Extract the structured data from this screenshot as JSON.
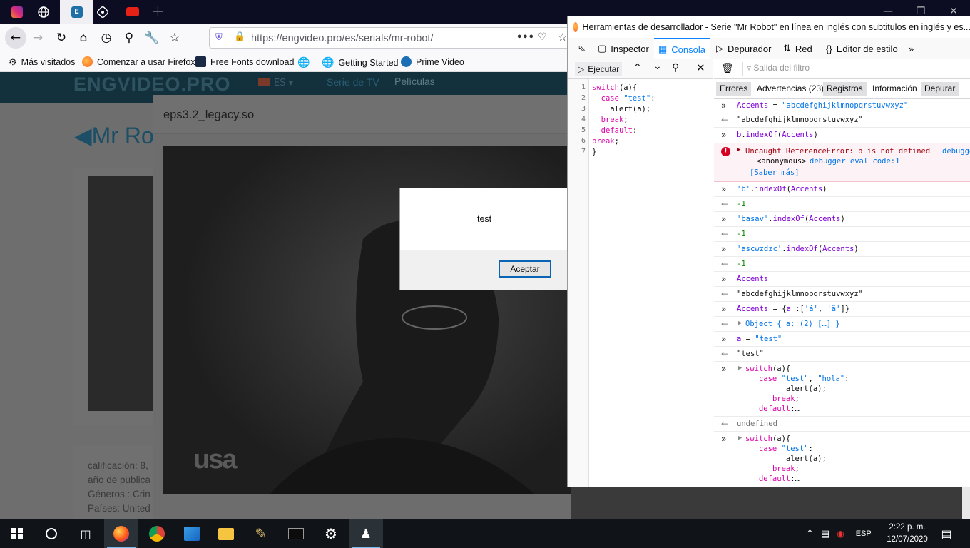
{
  "browser": {
    "tabs": [
      {
        "icon": "instagram-icon",
        "color": "#c13584"
      },
      {
        "icon": "globe-icon",
        "color": "#ffffff"
      },
      {
        "icon": "engvideo-icon",
        "color": "#2a7fb8"
      },
      {
        "icon": "app-icon",
        "color": "#ffffff"
      },
      {
        "icon": "youtube-icon",
        "color": "#e62117"
      }
    ],
    "new_tab": "+",
    "url": "https://engvideo.pro/es/serials/mr-robot/",
    "url_more": "•••",
    "bookmarks": [
      {
        "label": "Más visitados",
        "icon": "gear-icon"
      },
      {
        "label": "Comenzar a usar Firefox",
        "icon": "firefox-icon"
      },
      {
        "label": "Free Fonts download",
        "icon": "fonts-icon"
      },
      {
        "label": "",
        "icon": "globe-icon"
      },
      {
        "label": "Getting Started",
        "icon": "globe-icon"
      },
      {
        "label": "Prime Video",
        "icon": "prime-icon"
      }
    ]
  },
  "site": {
    "logo": "ENGVIDEO.PRO",
    "lang": "ES",
    "nav": [
      "Serie de TV",
      "Películas"
    ],
    "page_title": "Mr Ro",
    "info": [
      "calificación: 8,",
      "año de publica",
      "Géneros : Crin",
      "Países: United"
    ],
    "modal_title": "eps3.2_legacy.so",
    "video_watermark": "usa"
  },
  "alert": {
    "message": "test",
    "ok": "Aceptar"
  },
  "devtools": {
    "title": "Herramientas de desarrollador - Serie \"Mr Robot\" en línea en inglés con subtitulos en inglés y es...",
    "tabs": [
      "Inspector",
      "Consola",
      "Depurador",
      "Red",
      "Editor de estilo"
    ],
    "run_label": "Ejecutar",
    "filter_placeholder": "Salida del filtro",
    "levels": [
      "Errores",
      "Advertencias (23)",
      "Registros",
      "Información",
      "Depurar"
    ],
    "code_lines": [
      "1",
      "2",
      "3",
      "4",
      "5",
      "6",
      "7"
    ],
    "error": {
      "text": "Uncaught ReferenceError: b is not defined",
      "source": "debugge",
      "trace": "<anonymous>",
      "trace_loc": "debugger eval code:1",
      "learn_more": "[Saber más]"
    },
    "results": {
      "accents_str": "\"abcdefghijklmnopqrstuvwxyz\"",
      "minus_one": "-1",
      "test_str": "\"test\"",
      "undefined": "undefined",
      "object": "Object { a: (2) […] }"
    }
  },
  "taskbar": {
    "lang": "ESP",
    "time": "2:22 p. m.",
    "date": "12/07/2020"
  },
  "colors": {
    "accent": "#0a84ff",
    "error_bg": "#fdf2f5",
    "error_text": "#a4000f"
  }
}
